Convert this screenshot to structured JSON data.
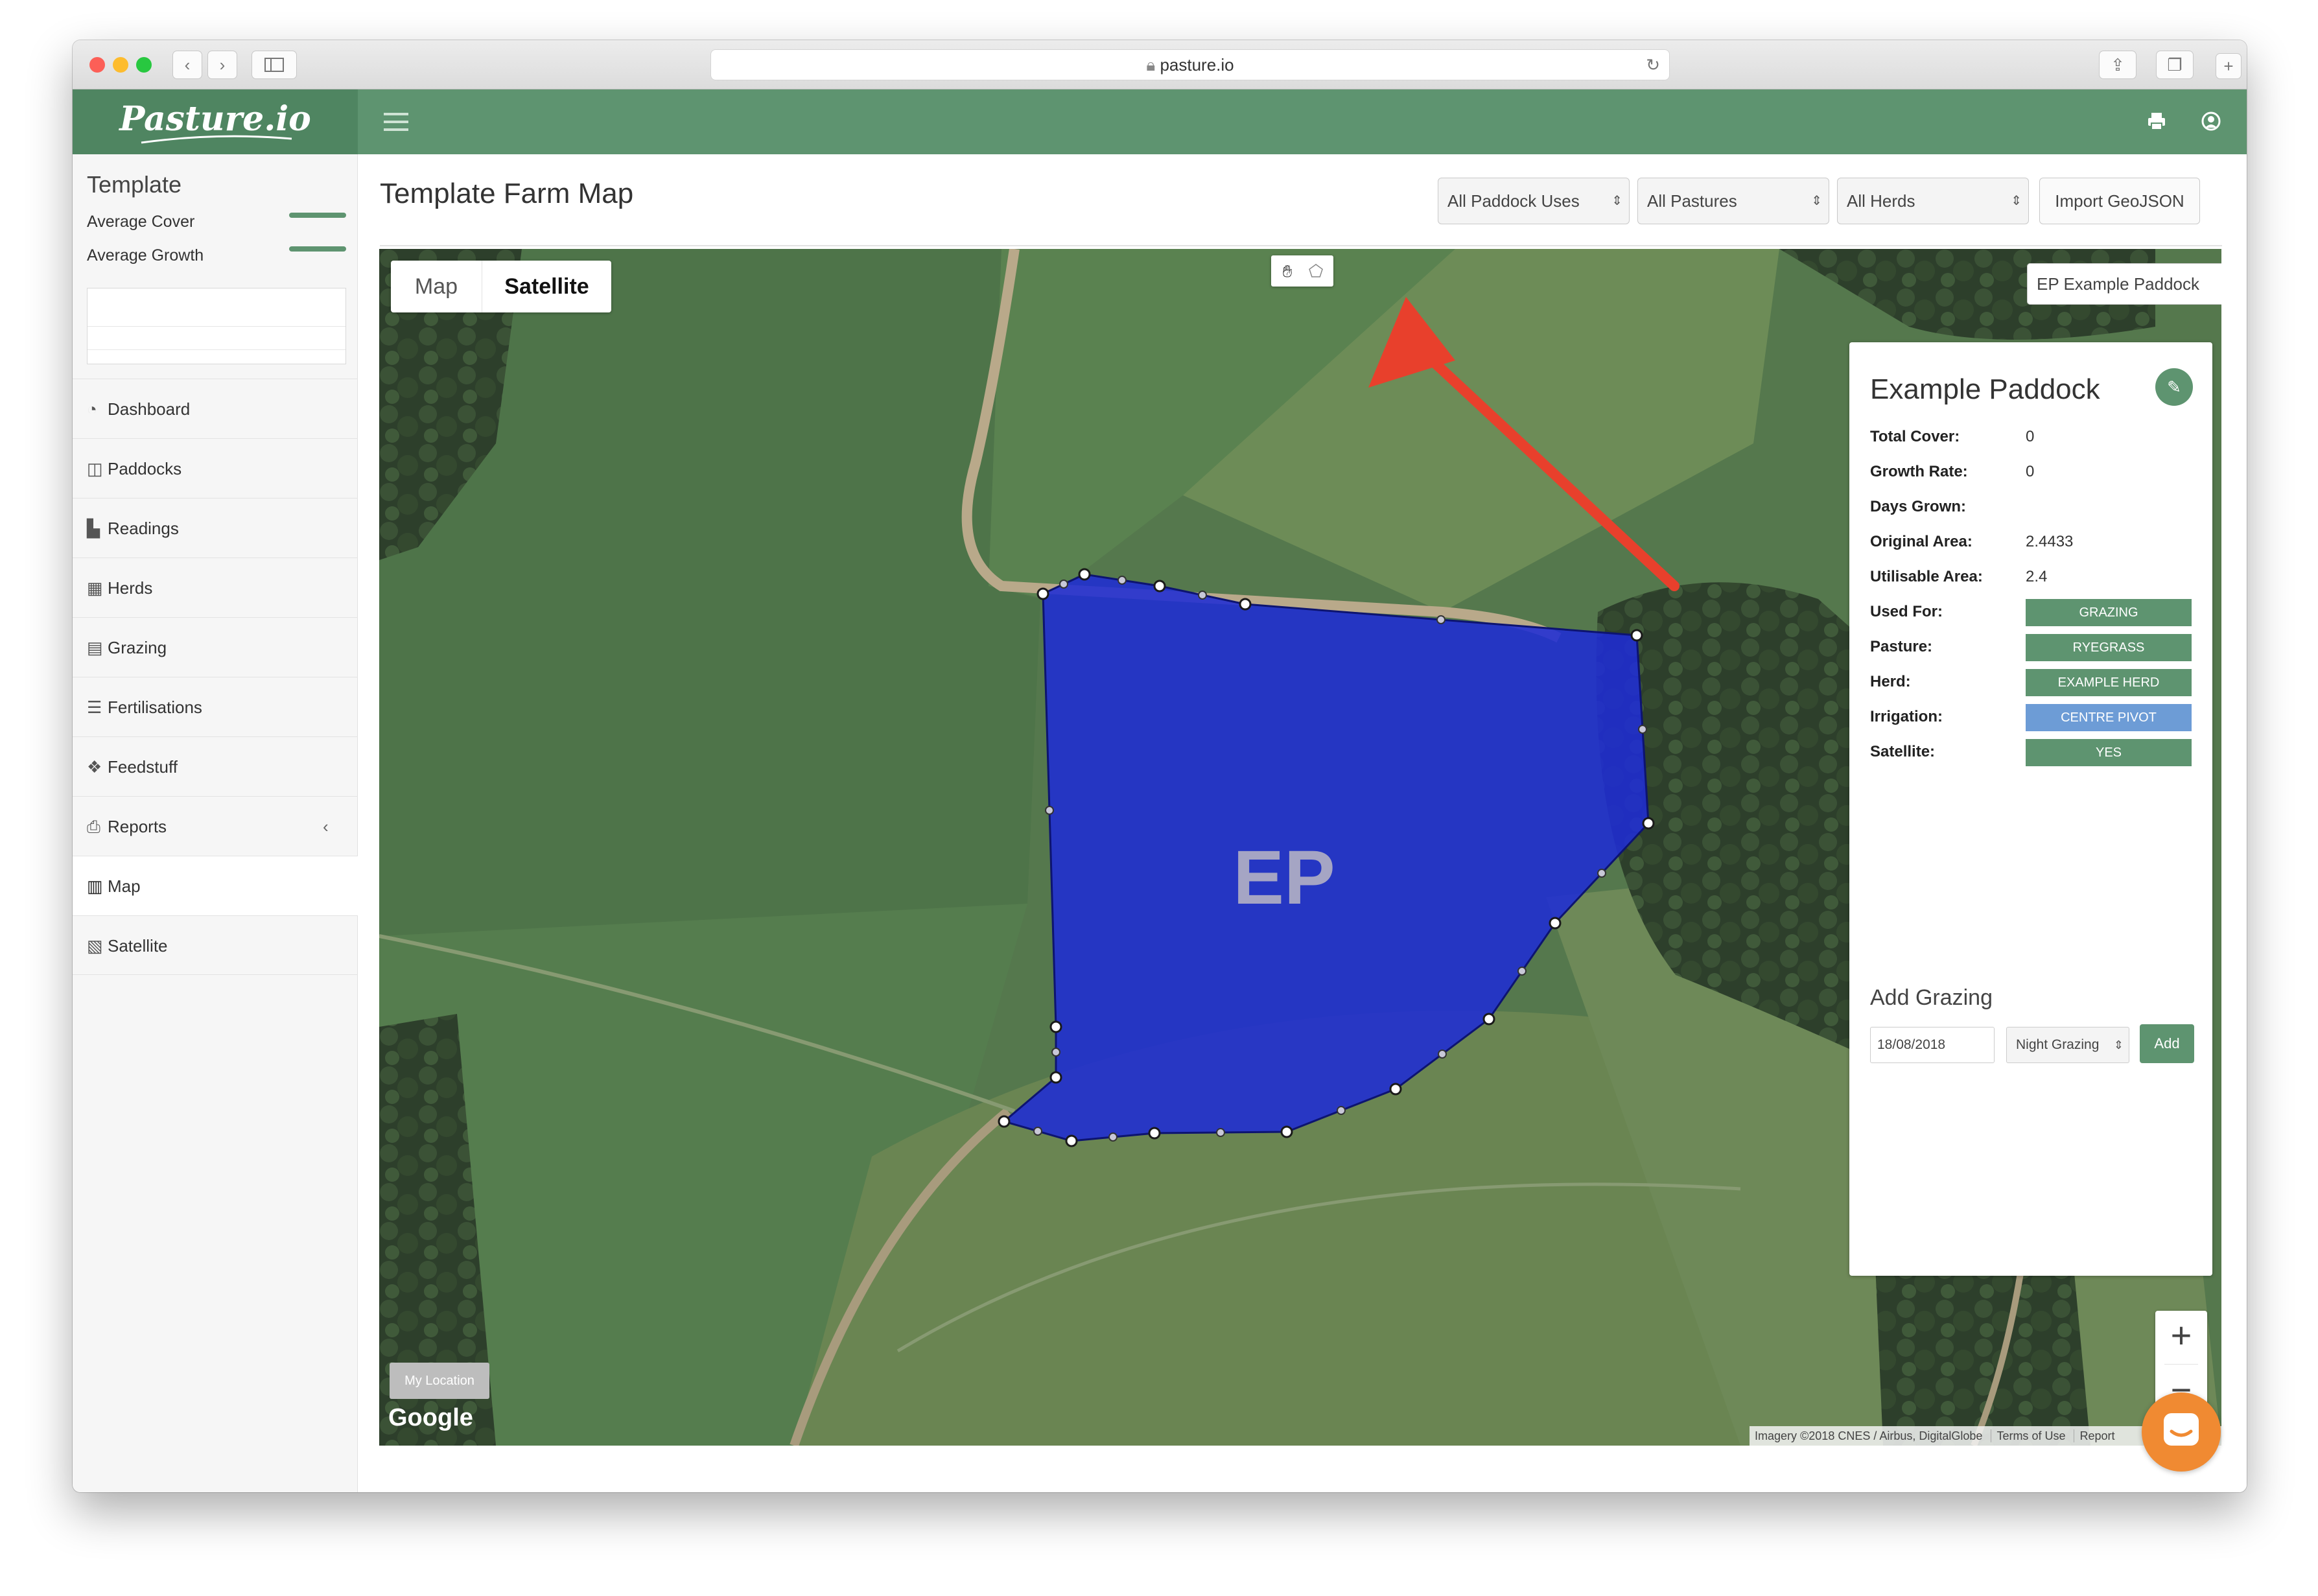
{
  "browser": {
    "url": "pasture.io"
  },
  "app": {
    "logo": "Pasture.io"
  },
  "sidebar": {
    "farm_name": "Template",
    "stats": [
      {
        "label": "Average Cover"
      },
      {
        "label": "Average Growth"
      }
    ],
    "nav": [
      {
        "label": "Dashboard",
        "icon": "dashboard-icon"
      },
      {
        "label": "Paddocks",
        "icon": "paddocks-icon"
      },
      {
        "label": "Readings",
        "icon": "bar-chart-icon"
      },
      {
        "label": "Herds",
        "icon": "grid-icon"
      },
      {
        "label": "Grazing",
        "icon": "calendar-icon"
      },
      {
        "label": "Fertilisations",
        "icon": "list-icon"
      },
      {
        "label": "Feedstuff",
        "icon": "cubes-icon"
      },
      {
        "label": "Reports",
        "icon": "print-icon"
      },
      {
        "label": "Map",
        "icon": "map-icon"
      },
      {
        "label": "Satellite",
        "icon": "image-icon"
      }
    ]
  },
  "page": {
    "title": "Template Farm Map",
    "filters": {
      "paddock_uses": "All Paddock Uses",
      "pastures": "All Pastures",
      "herds": "All Herds"
    },
    "import_button": "Import GeoJSON"
  },
  "map": {
    "type_tabs": [
      "Map",
      "Satellite"
    ],
    "active_tab": "Satellite",
    "paddock_select": "EP Example Paddock",
    "paddock_label": "EP",
    "my_location": "My Location",
    "google": "Google",
    "attribution": "Imagery ©2018 CNES / Airbus, DigitalGlobe",
    "terms": "Terms of Use",
    "report": "Report"
  },
  "info_panel": {
    "title": "Example Paddock",
    "fields": {
      "total_cover_label": "Total Cover:",
      "total_cover": "0",
      "growth_rate_label": "Growth Rate:",
      "growth_rate": "0",
      "days_grown_label": "Days Grown:",
      "original_area_label": "Original Area:",
      "original_area": "2.4433",
      "utilisable_area_label": "Utilisable Area:",
      "utilisable_area": "2.4",
      "used_for_label": "Used For:",
      "used_for": "GRAZING",
      "pasture_label": "Pasture:",
      "pasture": "RYEGRASS",
      "herd_label": "Herd:",
      "herd": "EXAMPLE HERD",
      "irrigation_label": "Irrigation:",
      "irrigation": "CENTRE PIVOT",
      "satellite_label": "Satellite:",
      "satellite": "YES"
    },
    "add_grazing": {
      "heading": "Add Grazing",
      "date": "18/08/2018",
      "type": "Night Grazing",
      "button": "Add"
    }
  },
  "colors": {
    "brand_green": "#5e9470",
    "irrigation_blue": "#6d9cd6",
    "paddock_fill": "#2230d0",
    "annotation_arrow": "#e8402c",
    "chat_orange": "#f08a32"
  }
}
